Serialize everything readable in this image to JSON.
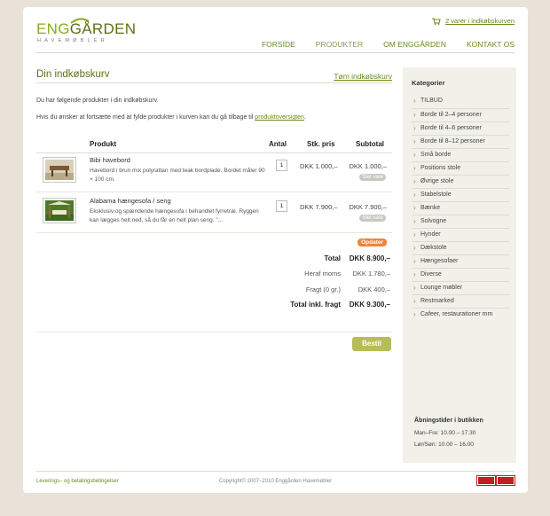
{
  "brand": {
    "logo_main_light": "ENG",
    "logo_main_dark": "GÅRDEN",
    "logo_sub": "HAVEMØBLER"
  },
  "header": {
    "cart_link": "2 varer i indkøbskurven"
  },
  "nav": [
    {
      "label": "Forside"
    },
    {
      "label": "Produkter"
    },
    {
      "label": "Om Enggården"
    },
    {
      "label": "Kontakt os"
    }
  ],
  "main": {
    "title": "Din indkøbskurv",
    "empty_link": "Tøm indkøbskurv",
    "intro1": "Du har følgende produkter i din indkøbskurv.",
    "intro2_prefix": "Hvis du ønsker at fortsætte med at fylde produkter i kurven kan du gå tilbage til ",
    "intro2_link": "produktoversigten",
    "intro2_suffix": "."
  },
  "table": {
    "headers": {
      "product": "Produkt",
      "qty": "Antal",
      "price": "Stk. pris",
      "subtotal": "Subtotal"
    },
    "rows": [
      {
        "name": "Bibi havebord",
        "desc": "Havebord i brun mix polyrattan med teak bordplade. Bordet måler 90 × 100 cm.",
        "qty": "1",
        "price": "DKK 1.000,–",
        "subtotal": "DKK 1.000,–",
        "delete": "Slet vare"
      },
      {
        "name": "Alabama hængesofa / seng",
        "desc": "Eksklusiv og spændende hængesofa i behandlet fyrretræ. Ryggen kan lægges helt ned, så du får en helt plan seng. \"...",
        "qty": "1",
        "price": "DKK 7.900,–",
        "subtotal": "DKK 7.900,–",
        "delete": "Slet vare"
      }
    ],
    "update_button": "Opdater"
  },
  "totals": {
    "total_label": "Total",
    "total_value": "DKK 8.900,–",
    "vat_label": "Heraf moms",
    "vat_value": "DKK 1.780,–",
    "shipping_label": "Fragt (0 gr.)",
    "shipping_value": "DKK 400,–",
    "grand_label": "Total inkl. fragt",
    "grand_value": "DKK 9.300,–"
  },
  "order_button": "Bestil",
  "sidebar": {
    "title": "Kategorier",
    "items": [
      "TILBUD",
      "Borde til 2–4 personer",
      "Borde til 4–6 personer",
      "Borde til 8–12 personer",
      "Små borde",
      "Positions stole",
      "Øvrige stole",
      "Stabelstole",
      "Bænke",
      "Solvogne",
      "Hynder",
      "Dækstole",
      "Hængesofaer",
      "Diverse",
      "Lounge møbler",
      "Restmarked",
      "Cafeer, restaurationer mm"
    ],
    "hours_title": "Åbningstider i butikken",
    "hours_line1": "Man–Fre: 10.00 – 17.30",
    "hours_line2": "Lør/Søn: 10.00 – 16.00"
  },
  "footer": {
    "link": "Leverings– og betalingsbetingelser",
    "copyright": "Copyright© 2007–2010 Enggården Havemøbler"
  },
  "colors": {
    "accent": "#6a8a1c",
    "update": "#f0843c",
    "order": "#b7bd57",
    "background": "#e8e2d8"
  }
}
